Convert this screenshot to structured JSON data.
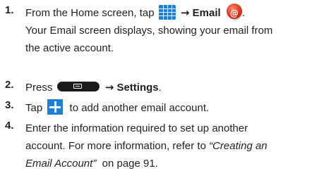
{
  "step1": {
    "number": "1.",
    "lead": "From the Home screen, tap",
    "arrow": "→",
    "target": "Email",
    "end": ".",
    "desc_line1": "Your Email screen displays, showing your email from",
    "desc_line2": "the active account."
  },
  "step2": {
    "number": "2.",
    "lead": "Press",
    "arrow": "→",
    "target": "Settings",
    "end": "."
  },
  "step3": {
    "number": "3.",
    "lead": "Tap",
    "rest": "to add another email account."
  },
  "step4": {
    "number": "4.",
    "line1": "Enter the information required to set up another",
    "line2_plain": "account. For more information, refer to ",
    "line2_link": "“Creating an",
    "line3_link": "Email Account”",
    "line3_rest": "  on page 91."
  },
  "icons": {
    "apps": "apps-grid-icon",
    "email": "email-app-icon",
    "menu": "menu-key-icon",
    "add": "plus-icon"
  }
}
